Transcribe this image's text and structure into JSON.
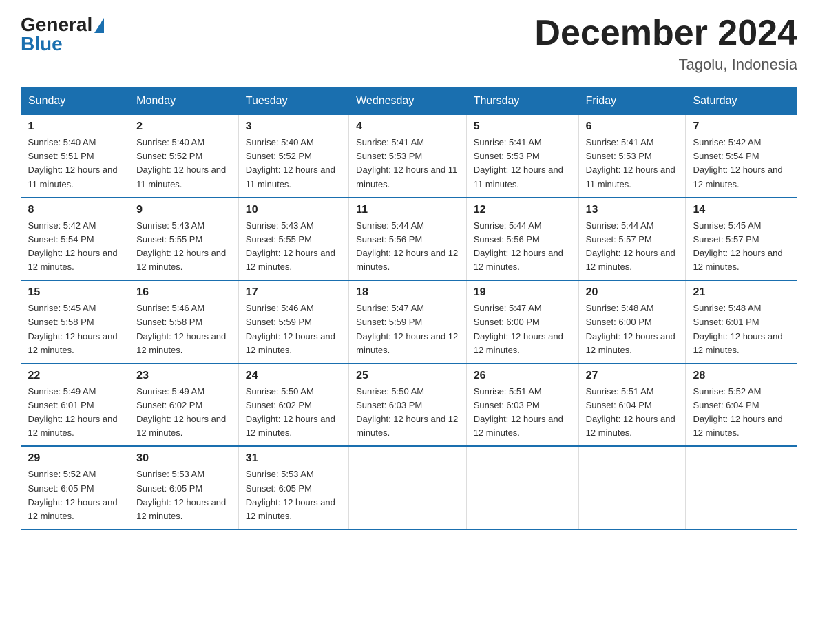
{
  "header": {
    "logo_general": "General",
    "logo_blue": "Blue",
    "main_title": "December 2024",
    "subtitle": "Tagolu, Indonesia"
  },
  "days_of_week": [
    "Sunday",
    "Monday",
    "Tuesday",
    "Wednesday",
    "Thursday",
    "Friday",
    "Saturday"
  ],
  "weeks": [
    [
      {
        "day": "1",
        "sunrise": "5:40 AM",
        "sunset": "5:51 PM",
        "daylight": "12 hours and 11 minutes."
      },
      {
        "day": "2",
        "sunrise": "5:40 AM",
        "sunset": "5:52 PM",
        "daylight": "12 hours and 11 minutes."
      },
      {
        "day": "3",
        "sunrise": "5:40 AM",
        "sunset": "5:52 PM",
        "daylight": "12 hours and 11 minutes."
      },
      {
        "day": "4",
        "sunrise": "5:41 AM",
        "sunset": "5:53 PM",
        "daylight": "12 hours and 11 minutes."
      },
      {
        "day": "5",
        "sunrise": "5:41 AM",
        "sunset": "5:53 PM",
        "daylight": "12 hours and 11 minutes."
      },
      {
        "day": "6",
        "sunrise": "5:41 AM",
        "sunset": "5:53 PM",
        "daylight": "12 hours and 11 minutes."
      },
      {
        "day": "7",
        "sunrise": "5:42 AM",
        "sunset": "5:54 PM",
        "daylight": "12 hours and 12 minutes."
      }
    ],
    [
      {
        "day": "8",
        "sunrise": "5:42 AM",
        "sunset": "5:54 PM",
        "daylight": "12 hours and 12 minutes."
      },
      {
        "day": "9",
        "sunrise": "5:43 AM",
        "sunset": "5:55 PM",
        "daylight": "12 hours and 12 minutes."
      },
      {
        "day": "10",
        "sunrise": "5:43 AM",
        "sunset": "5:55 PM",
        "daylight": "12 hours and 12 minutes."
      },
      {
        "day": "11",
        "sunrise": "5:44 AM",
        "sunset": "5:56 PM",
        "daylight": "12 hours and 12 minutes."
      },
      {
        "day": "12",
        "sunrise": "5:44 AM",
        "sunset": "5:56 PM",
        "daylight": "12 hours and 12 minutes."
      },
      {
        "day": "13",
        "sunrise": "5:44 AM",
        "sunset": "5:57 PM",
        "daylight": "12 hours and 12 minutes."
      },
      {
        "day": "14",
        "sunrise": "5:45 AM",
        "sunset": "5:57 PM",
        "daylight": "12 hours and 12 minutes."
      }
    ],
    [
      {
        "day": "15",
        "sunrise": "5:45 AM",
        "sunset": "5:58 PM",
        "daylight": "12 hours and 12 minutes."
      },
      {
        "day": "16",
        "sunrise": "5:46 AM",
        "sunset": "5:58 PM",
        "daylight": "12 hours and 12 minutes."
      },
      {
        "day": "17",
        "sunrise": "5:46 AM",
        "sunset": "5:59 PM",
        "daylight": "12 hours and 12 minutes."
      },
      {
        "day": "18",
        "sunrise": "5:47 AM",
        "sunset": "5:59 PM",
        "daylight": "12 hours and 12 minutes."
      },
      {
        "day": "19",
        "sunrise": "5:47 AM",
        "sunset": "6:00 PM",
        "daylight": "12 hours and 12 minutes."
      },
      {
        "day": "20",
        "sunrise": "5:48 AM",
        "sunset": "6:00 PM",
        "daylight": "12 hours and 12 minutes."
      },
      {
        "day": "21",
        "sunrise": "5:48 AM",
        "sunset": "6:01 PM",
        "daylight": "12 hours and 12 minutes."
      }
    ],
    [
      {
        "day": "22",
        "sunrise": "5:49 AM",
        "sunset": "6:01 PM",
        "daylight": "12 hours and 12 minutes."
      },
      {
        "day": "23",
        "sunrise": "5:49 AM",
        "sunset": "6:02 PM",
        "daylight": "12 hours and 12 minutes."
      },
      {
        "day": "24",
        "sunrise": "5:50 AM",
        "sunset": "6:02 PM",
        "daylight": "12 hours and 12 minutes."
      },
      {
        "day": "25",
        "sunrise": "5:50 AM",
        "sunset": "6:03 PM",
        "daylight": "12 hours and 12 minutes."
      },
      {
        "day": "26",
        "sunrise": "5:51 AM",
        "sunset": "6:03 PM",
        "daylight": "12 hours and 12 minutes."
      },
      {
        "day": "27",
        "sunrise": "5:51 AM",
        "sunset": "6:04 PM",
        "daylight": "12 hours and 12 minutes."
      },
      {
        "day": "28",
        "sunrise": "5:52 AM",
        "sunset": "6:04 PM",
        "daylight": "12 hours and 12 minutes."
      }
    ],
    [
      {
        "day": "29",
        "sunrise": "5:52 AM",
        "sunset": "6:05 PM",
        "daylight": "12 hours and 12 minutes."
      },
      {
        "day": "30",
        "sunrise": "5:53 AM",
        "sunset": "6:05 PM",
        "daylight": "12 hours and 12 minutes."
      },
      {
        "day": "31",
        "sunrise": "5:53 AM",
        "sunset": "6:05 PM",
        "daylight": "12 hours and 12 minutes."
      },
      null,
      null,
      null,
      null
    ]
  ]
}
